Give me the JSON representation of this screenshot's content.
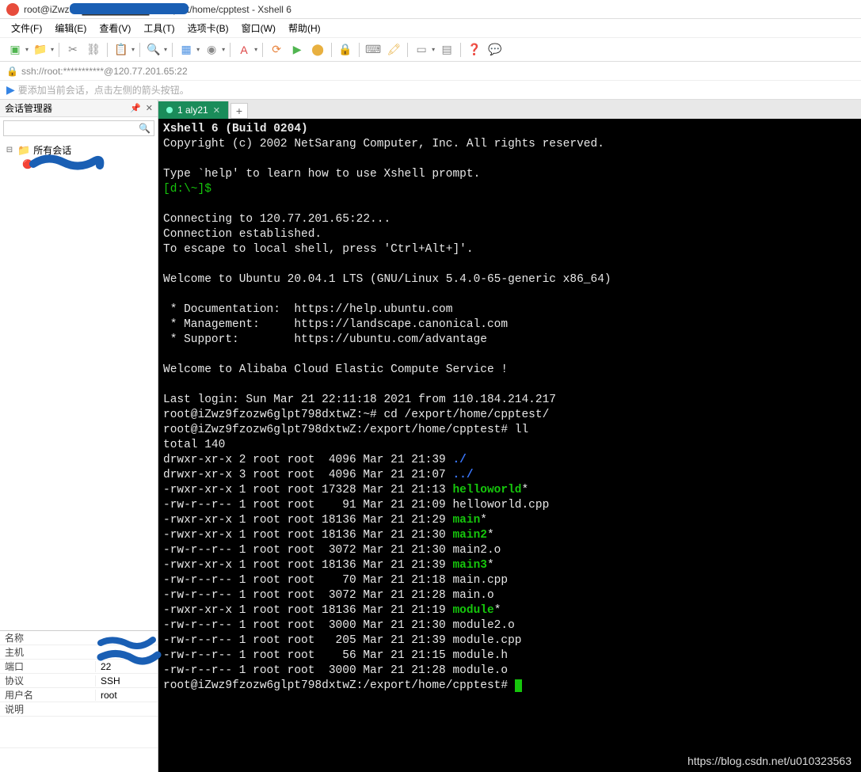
{
  "title": "root@iZwz9fz██████████Z: /export/home/cpptest - Xshell 6",
  "menus": [
    "文件(F)",
    "编辑(E)",
    "查看(V)",
    "工具(T)",
    "选项卡(B)",
    "窗口(W)",
    "帮助(H)"
  ],
  "address": "ssh://root:***********@120.77.201.65:22",
  "hint": "要添加当前会话，点击左侧的箭头按钮。",
  "sidebar_title": "会话管理器",
  "tree_root": "所有会话",
  "props": {
    "name_label": "名称",
    "host_label": "主机",
    "port_label": "端口",
    "port_value": "22",
    "proto_label": "协议",
    "proto_value": "SSH",
    "user_label": "用户名",
    "user_value": "root",
    "desc_label": "说明"
  },
  "tab_label": "1 aly21",
  "term": {
    "l1": "Xshell 6 (Build 0204)",
    "l2": "Copyright (c) 2002 NetSarang Computer, Inc. All rights reserved.",
    "l3": "Type `help' to learn how to use Xshell prompt.",
    "prompt1": "[d:\\~]$",
    "l4": "Connecting to 120.77.201.65:22...",
    "l5": "Connection established.",
    "l6": "To escape to local shell, press 'Ctrl+Alt+]'.",
    "l7": "Welcome to Ubuntu 20.04.1 LTS (GNU/Linux 5.4.0-65-generic x86_64)",
    "l8": " * Documentation:  https://help.ubuntu.com",
    "l9": " * Management:     https://landscape.canonical.com",
    "l10": " * Support:        https://ubuntu.com/advantage",
    "l11": "Welcome to Alibaba Cloud Elastic Compute Service !",
    "l12": "Last login: Sun Mar 21 22:11:18 2021 from 110.184.214.217",
    "l13": "root@iZwz9fzozw6glpt798dxtwZ:~# cd /export/home/cpptest/",
    "l14": "root@iZwz9fzozw6glpt798dxtwZ:/export/home/cpptest# ll",
    "l15": "total 140",
    "ls": [
      {
        "perm": "drwxr-xr-x 2 root root  4096 Mar 21 21:39 ",
        "name": "./",
        "cls": "t-blue"
      },
      {
        "perm": "drwxr-xr-x 3 root root  4096 Mar 21 21:07 ",
        "name": "../",
        "cls": "t-blue"
      },
      {
        "perm": "-rwxr-xr-x 1 root root 17328 Mar 21 21:13 ",
        "name": "helloworld",
        "suf": "*",
        "cls": "t-green"
      },
      {
        "perm": "-rw-r--r-- 1 root root    91 Mar 21 21:09 ",
        "name": "helloworld.cpp",
        "cls": ""
      },
      {
        "perm": "-rwxr-xr-x 1 root root 18136 Mar 21 21:29 ",
        "name": "main",
        "suf": "*",
        "cls": "t-green"
      },
      {
        "perm": "-rwxr-xr-x 1 root root 18136 Mar 21 21:30 ",
        "name": "main2",
        "suf": "*",
        "cls": "t-green"
      },
      {
        "perm": "-rw-r--r-- 1 root root  3072 Mar 21 21:30 ",
        "name": "main2.o",
        "cls": ""
      },
      {
        "perm": "-rwxr-xr-x 1 root root 18136 Mar 21 21:39 ",
        "name": "main3",
        "suf": "*",
        "cls": "t-green"
      },
      {
        "perm": "-rw-r--r-- 1 root root    70 Mar 21 21:18 ",
        "name": "main.cpp",
        "cls": ""
      },
      {
        "perm": "-rw-r--r-- 1 root root  3072 Mar 21 21:28 ",
        "name": "main.o",
        "cls": ""
      },
      {
        "perm": "-rwxr-xr-x 1 root root 18136 Mar 21 21:19 ",
        "name": "module",
        "suf": "*",
        "cls": "t-green"
      },
      {
        "perm": "-rw-r--r-- 1 root root  3000 Mar 21 21:30 ",
        "name": "module2.o",
        "cls": ""
      },
      {
        "perm": "-rw-r--r-- 1 root root   205 Mar 21 21:39 ",
        "name": "module.cpp",
        "cls": ""
      },
      {
        "perm": "-rw-r--r-- 1 root root    56 Mar 21 21:15 ",
        "name": "module.h",
        "cls": ""
      },
      {
        "perm": "-rw-r--r-- 1 root root  3000 Mar 21 21:28 ",
        "name": "module.o",
        "cls": ""
      }
    ],
    "prompt2": "root@iZwz9fzozw6glpt798dxtwZ:/export/home/cpptest# "
  },
  "watermark": "https://blog.csdn.net/u010323563"
}
